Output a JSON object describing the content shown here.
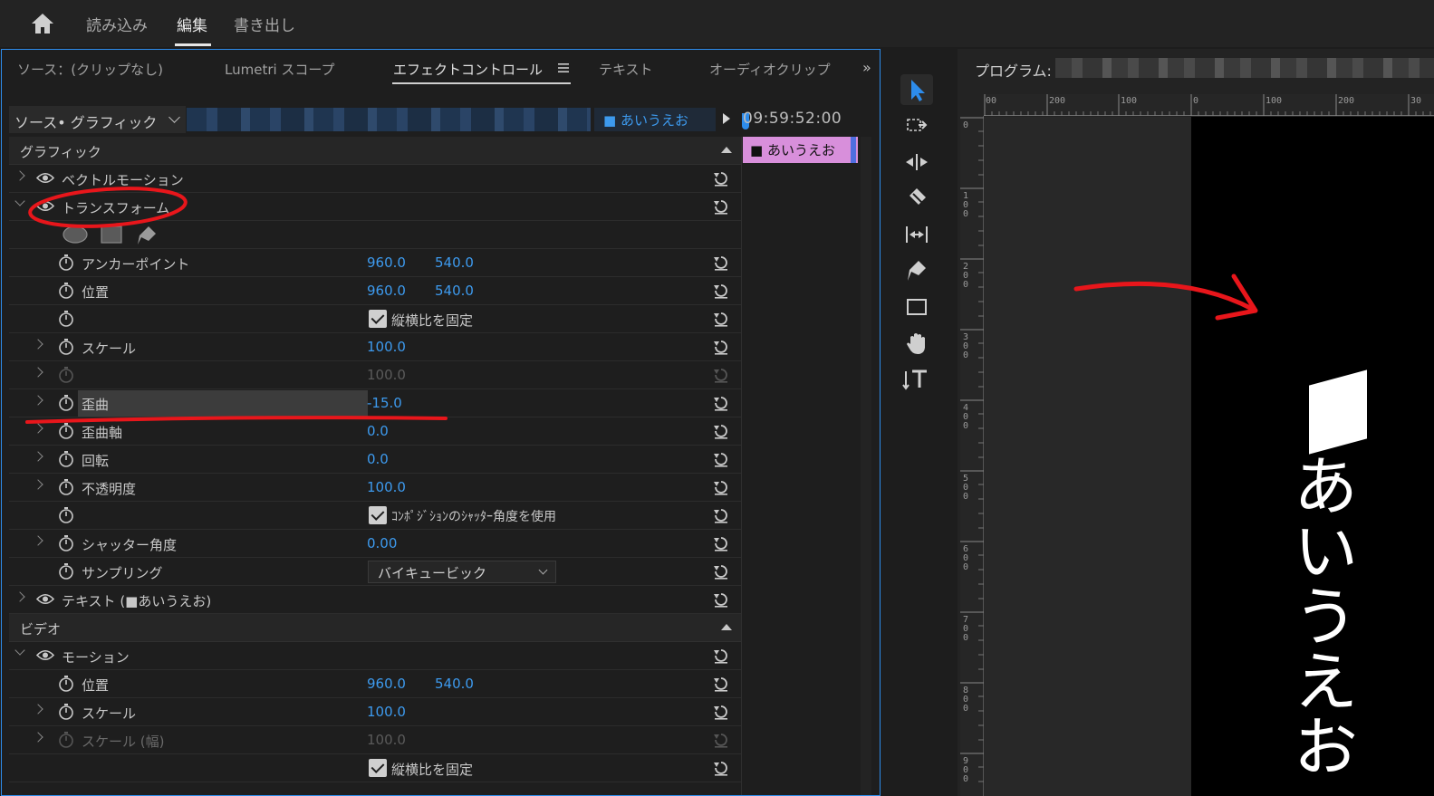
{
  "topbar": {
    "home_icon": "home-icon",
    "tabs": [
      {
        "label": "読み込み"
      },
      {
        "label": "編集"
      },
      {
        "label": "書き出し"
      }
    ],
    "active_tab": "編集"
  },
  "effect_panel": {
    "tabs": [
      {
        "label": "ソース：(クリップなし)"
      },
      {
        "label": "Lumetri スコープ"
      },
      {
        "label": "エフェクトコントロール"
      },
      {
        "label": "テキスト"
      },
      {
        "label": "オーディオクリップ"
      }
    ],
    "active_tab": "エフェクトコントロール",
    "overflow_icon": "double-chevron-right-icon",
    "source_selector": "ソース• グラフィック",
    "clip_selector": "■ あいうえお",
    "timecode": "09:59:52:00",
    "timeline_clip_label": "■ あいうえお",
    "sections": {
      "graphic": "グラフィック",
      "vector_motion": "ベクトルモーション",
      "transform": "トランスフォーム",
      "anchor_label": "アンカーポイント",
      "anchor_x": "960.0",
      "anchor_y": "540.0",
      "position_label": "位置",
      "position_x": "960.0",
      "position_y": "540.0",
      "uniform_scale": "縦横比を固定",
      "scale_label": "スケール",
      "scale_value": "100.0",
      "scale_width_value": "100.0",
      "skew_label": "歪曲",
      "skew_value": "-15.0",
      "skew_axis_label": "歪曲軸",
      "skew_axis_value": "0.0",
      "rotation_label": "回転",
      "rotation_value": "0.0",
      "opacity_label": "不透明度",
      "opacity_value": "100.0",
      "use_comp_shutter": "ｺﾝﾎﾟｼﾞｼｮﾝのｼｬｯﾀｰ角度を使用",
      "shutter_label": "シャッター角度",
      "shutter_value": "0.00",
      "sampling_label": "サンプリング",
      "sampling_value": "バイキュービック",
      "text_layer": "テキスト (■あいうえお)",
      "video": "ビデオ",
      "motion": "モーション",
      "motion_position_label": "位置",
      "motion_position_x": "960.0",
      "motion_position_y": "540.0",
      "motion_scale_label": "スケール",
      "motion_scale_value": "100.0",
      "motion_scale_width_label": "スケール (幅)",
      "motion_scale_width_value": "100.0",
      "motion_uniform_scale": "縦横比を固定"
    }
  },
  "tools": [
    {
      "name": "selection-tool-icon",
      "selected": true
    },
    {
      "name": "track-select-tool-icon"
    },
    {
      "name": "ripple-edit-tool-icon"
    },
    {
      "name": "razor-tool-icon"
    },
    {
      "name": "slip-tool-icon"
    },
    {
      "name": "pen-tool-icon"
    },
    {
      "name": "rectangle-tool-icon"
    },
    {
      "name": "hand-tool-icon"
    },
    {
      "name": "vertical-type-tool-icon"
    }
  ],
  "program_monitor": {
    "title": "プログラム:",
    "ruler_h": [
      "00",
      "200",
      "100",
      "0",
      "100",
      "200",
      "30"
    ],
    "ruler_v": [
      "0",
      "100",
      "200",
      "300",
      "400",
      "500",
      "600",
      "700",
      "800",
      "900"
    ],
    "frame_text": "あいうえお"
  },
  "colors": {
    "accent_blue": "#2d8ceb",
    "value_blue": "#3d9aee",
    "annotation_red": "#e8161b",
    "clip_pink": "#d88fdb"
  }
}
